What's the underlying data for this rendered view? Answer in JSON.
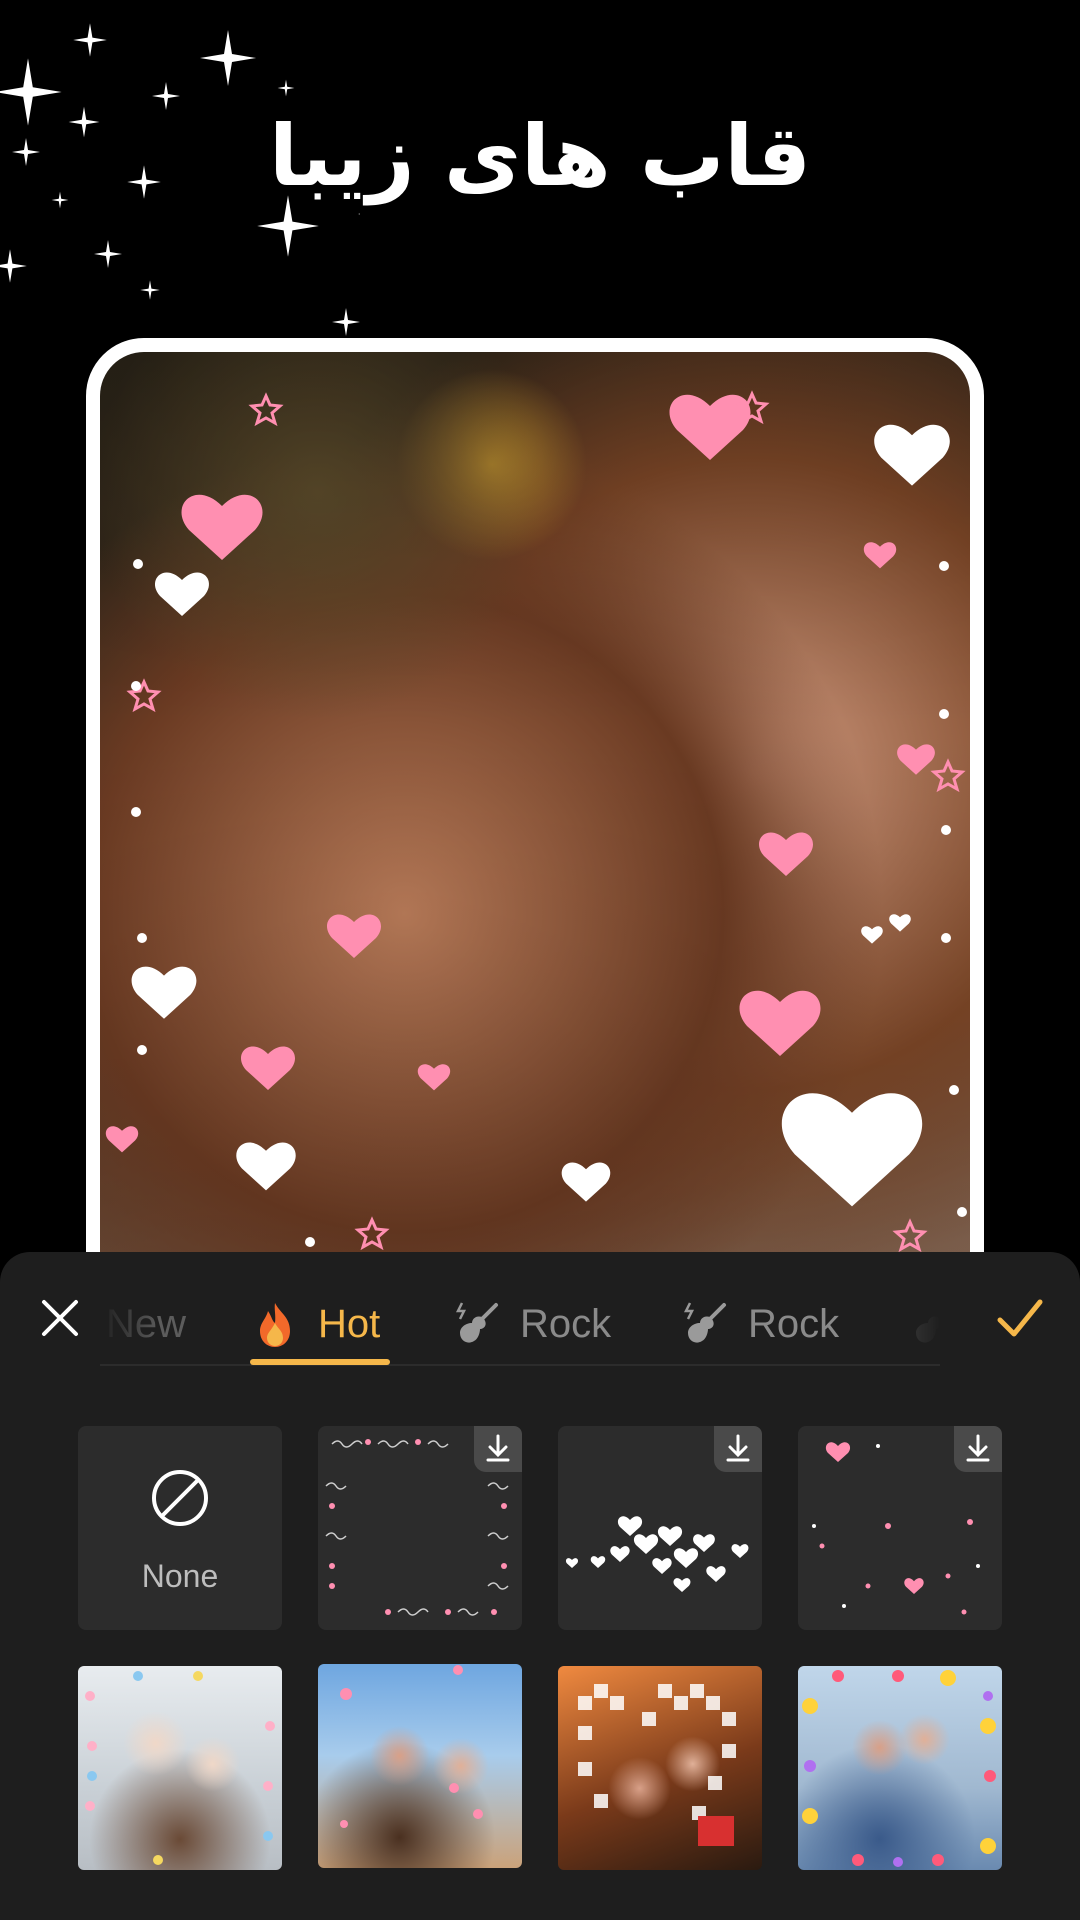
{
  "headline": "قاب های زیبا",
  "colors": {
    "accent": "#f5b74a",
    "panel": "#1e1e1e",
    "tile": "#2c2c2c",
    "heart_pink": "#ff8fb1"
  },
  "toolbar": {
    "close_icon": "close-icon",
    "confirm_icon": "checkmark-icon"
  },
  "tabs": [
    {
      "label": "New",
      "icon": "",
      "state": "faded"
    },
    {
      "label": "Hot",
      "icon": "fire-icon",
      "state": "active"
    },
    {
      "label": "Rock",
      "icon": "guitar-icon",
      "state": "normal"
    },
    {
      "label": "Rock",
      "icon": "guitar-icon",
      "state": "normal"
    }
  ],
  "frames": {
    "none_label": "None",
    "row1": [
      {
        "name": "none",
        "download": false
      },
      {
        "name": "love-text-frame",
        "download": true
      },
      {
        "name": "white-hearts-frame",
        "download": true
      },
      {
        "name": "scattered-hearts-frame",
        "download": true
      }
    ],
    "row2": [
      {
        "name": "winter-couple-frame"
      },
      {
        "name": "kiss-couple-frame"
      },
      {
        "name": "pixel-heart-frame"
      },
      {
        "name": "emoji-frame"
      }
    ]
  }
}
